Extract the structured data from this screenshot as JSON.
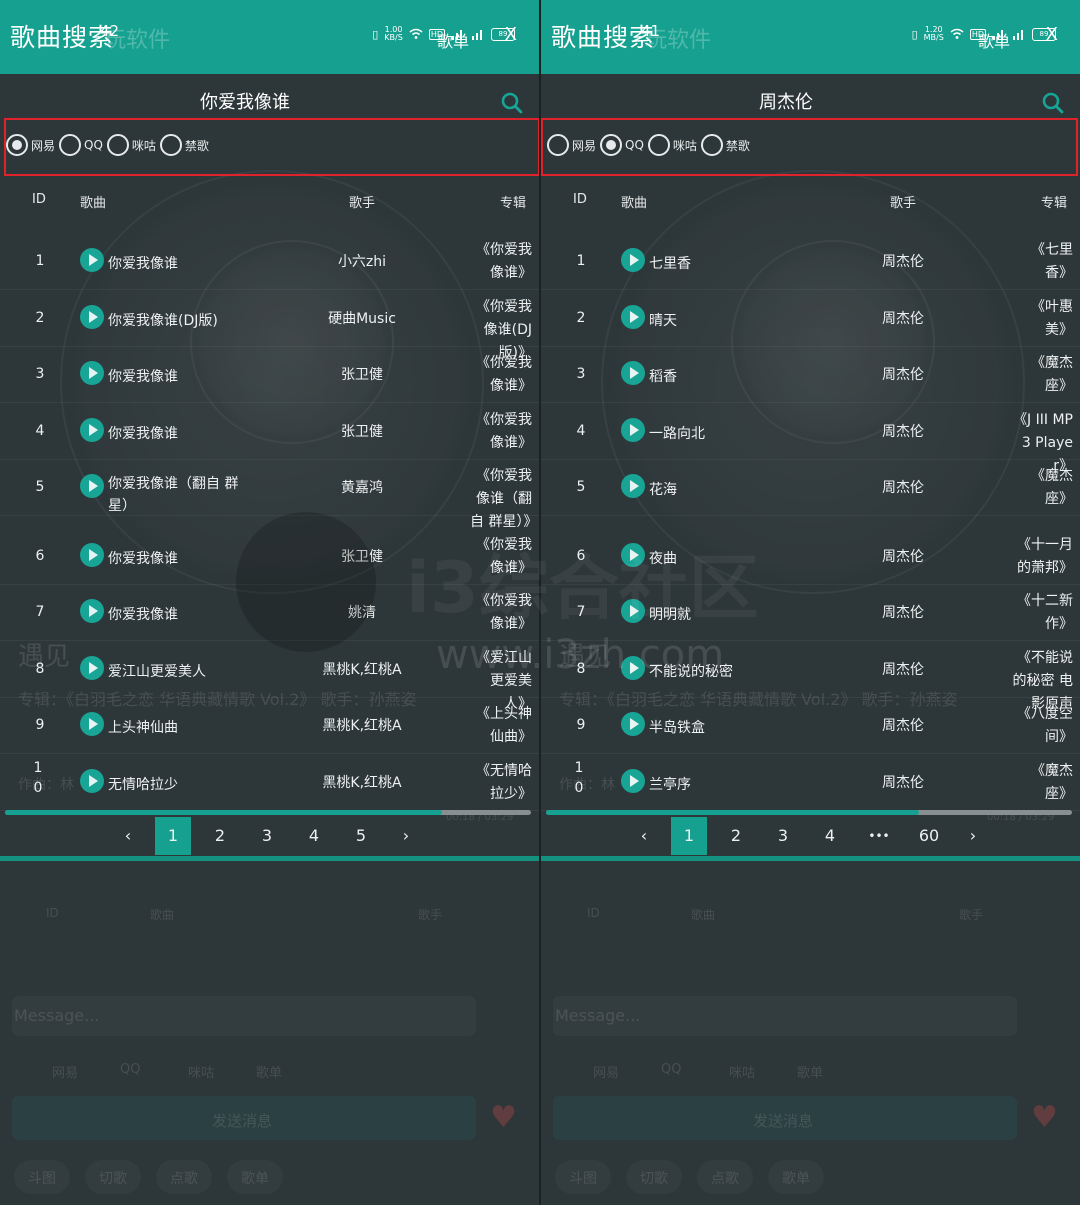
{
  "left": {
    "app_title": "歌曲搜索",
    "title_ghost": "玩软件",
    "clock": "42",
    "speed": "1.00\nKB/S",
    "battery": "89",
    "menu_label": "歌单",
    "close_label": "X",
    "query": "你爱我像谁",
    "sources": [
      {
        "label": "网易",
        "selected": true
      },
      {
        "label": "QQ",
        "selected": false
      },
      {
        "label": "咪咕",
        "selected": false
      },
      {
        "label": "禁歌",
        "selected": false
      }
    ],
    "columns": {
      "id": "ID",
      "song": "歌曲",
      "artist": "歌手",
      "album": "专辑"
    },
    "rows": [
      {
        "id": "1",
        "song": "你爱我像谁",
        "artist": "小六zhi",
        "album": "《你爱我像谁》"
      },
      {
        "id": "2",
        "song": "你爱我像谁(DJ版)",
        "artist": "硬曲Music",
        "album": "《你爱我像谁(DJ版)》"
      },
      {
        "id": "3",
        "song": "你爱我像谁",
        "artist": "张卫健",
        "album": "《你爱我像谁》"
      },
      {
        "id": "4",
        "song": "你爱我像谁",
        "artist": "张卫健",
        "album": "《你爱我像谁》"
      },
      {
        "id": "5",
        "song": "你爱我像谁（翻自 群星）",
        "artist": "黄嘉鸿",
        "album": "《你爱我像谁（翻自 群星）》"
      },
      {
        "id": "6",
        "song": "你爱我像谁",
        "artist": "张卫健",
        "album": "《你爱我像谁》"
      },
      {
        "id": "7",
        "song": "你爱我像谁",
        "artist": "姚清",
        "album": "《你爱我像谁》"
      },
      {
        "id": "8",
        "song": "爱江山更爱美人",
        "artist": "黑桃K,红桃A",
        "album": "《爱江山更爱美人》"
      },
      {
        "id": "9",
        "song": "上头神仙曲",
        "artist": "黑桃K,红桃A",
        "album": "《上头神仙曲》"
      },
      {
        "id": "10",
        "song": "无情哈拉少",
        "artist": "黑桃K,红桃A",
        "album": "《无情哈拉少》"
      }
    ],
    "progress": 0.83,
    "pages": [
      "‹",
      "1",
      "2",
      "3",
      "4",
      "5",
      "›"
    ],
    "active_page": "1"
  },
  "right": {
    "app_title": "歌曲搜索",
    "title_ghost": "玩软件",
    "clock": "41",
    "speed": "1.20\nMB/S",
    "battery": "89",
    "menu_label": "歌单",
    "close_label": "X",
    "query": "周杰伦",
    "sources": [
      {
        "label": "网易",
        "selected": false
      },
      {
        "label": "QQ",
        "selected": true
      },
      {
        "label": "咪咕",
        "selected": false
      },
      {
        "label": "禁歌",
        "selected": false
      }
    ],
    "columns": {
      "id": "ID",
      "song": "歌曲",
      "artist": "歌手",
      "album": "专辑"
    },
    "rows": [
      {
        "id": "1",
        "song": "七里香",
        "artist": "周杰伦",
        "album": "《七里香》"
      },
      {
        "id": "2",
        "song": "晴天",
        "artist": "周杰伦",
        "album": "《叶惠美》"
      },
      {
        "id": "3",
        "song": "稻香",
        "artist": "周杰伦",
        "album": "《魔杰座》"
      },
      {
        "id": "4",
        "song": "一路向北",
        "artist": "周杰伦",
        "album": "《J III MP3 Player》"
      },
      {
        "id": "5",
        "song": "花海",
        "artist": "周杰伦",
        "album": "《魔杰座》"
      },
      {
        "id": "6",
        "song": "夜曲",
        "artist": "周杰伦",
        "album": "《十一月的萧邦》"
      },
      {
        "id": "7",
        "song": "明明就",
        "artist": "周杰伦",
        "album": "《十二新作》"
      },
      {
        "id": "8",
        "song": "不能说的秘密",
        "artist": "周杰伦",
        "album": "《不能说的秘密 电影原声带》"
      },
      {
        "id": "9",
        "song": "半岛铁盒",
        "artist": "周杰伦",
        "album": "《八度空间》"
      },
      {
        "id": "10",
        "song": "兰亭序",
        "artist": "周杰伦",
        "album": "《魔杰座》"
      }
    ],
    "progress": 0.71,
    "pages": [
      "‹",
      "1",
      "2",
      "3",
      "4",
      "•••",
      "60",
      "›"
    ],
    "active_page": "1"
  },
  "colors": {
    "accent": "#15a08f",
    "play": "#18a596",
    "highlight": "#e0222a",
    "background": "#2d3639"
  },
  "watermark": {
    "site": "www.i3zh.com",
    "brand": "i3综合社区"
  },
  "ghost_ui": {
    "song_title": "遇见",
    "song_meta": "专辑：《白羽毛之恋 华语典藏情歌 Vol.2》 歌手：孙燕姿",
    "time": "00:18 / 03:29",
    "lyric": "作曲：林",
    "th_id": "ID",
    "th_song": "歌曲",
    "th_artist": "歌手",
    "message": "Message...",
    "send": "发送消息",
    "tabs": [
      "斗图",
      "切歌",
      "点歌",
      "歌单"
    ],
    "radios": [
      "网易",
      "QQ",
      "咪咕",
      "歌单"
    ]
  },
  "icons": {
    "search": "search-icon",
    "play": "play-icon",
    "close": "close-icon",
    "battery": "battery-icon",
    "wifi": "wifi-icon",
    "signal": "signal-icon"
  }
}
